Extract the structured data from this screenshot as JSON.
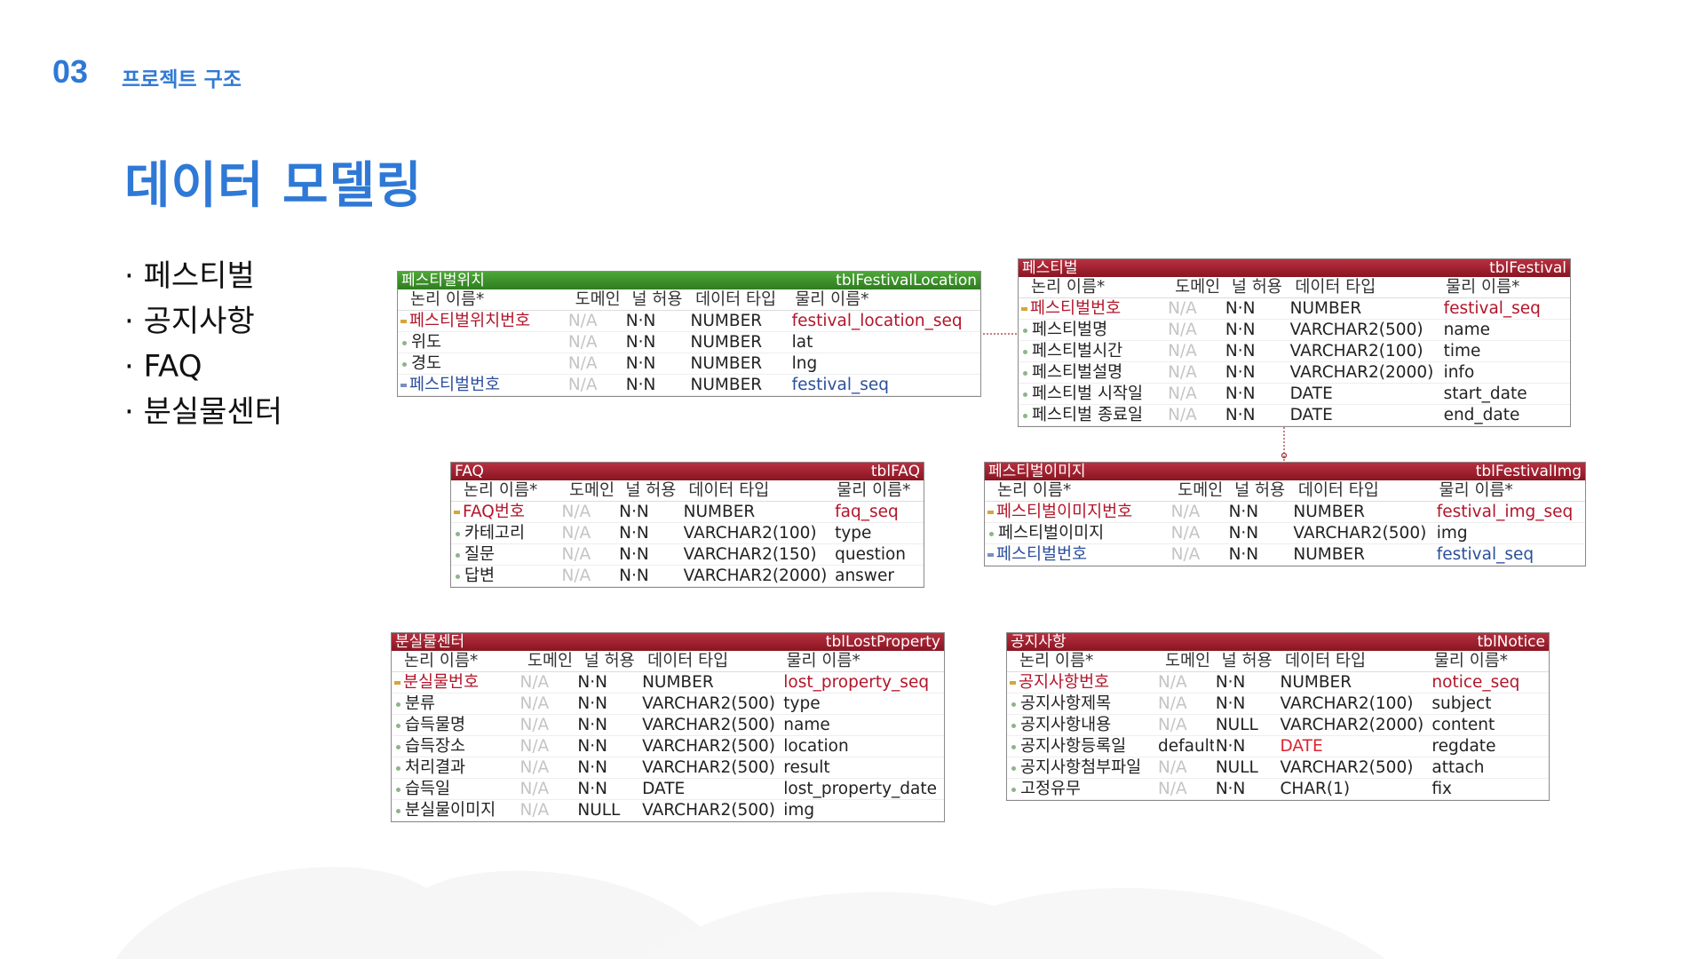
{
  "header": {
    "section_number": "03",
    "section_title": "프로젝트 구조"
  },
  "title": "데이터 모델링",
  "topics": [
    "페스티벌",
    "공지사항",
    "FAQ",
    "분실물센터"
  ],
  "erd_columns": {
    "logical": "논리 이름*",
    "domain": "도메인",
    "nullable": "널 허용",
    "datatype": "데이터 타입",
    "physical": "물리 이름*"
  },
  "colors": {
    "accent": "#2f79d6",
    "entity_header": "#8a1522",
    "location_header": "#2f7d1f",
    "pk_text": "#b3152a",
    "fk_text": "#2a4f9c"
  },
  "tables": {
    "location": {
      "logical": "페스티벌위치",
      "physical": "tblFestivalLocation",
      "rows": [
        {
          "kind": "pk",
          "logical": "페스티벌위치번호",
          "domain": "N/A",
          "nullable": "N·N",
          "datatype": "NUMBER",
          "physical": "festival_location_seq"
        },
        {
          "kind": "col",
          "logical": "위도",
          "domain": "N/A",
          "nullable": "N·N",
          "datatype": "NUMBER",
          "physical": "lat"
        },
        {
          "kind": "col",
          "logical": "경도",
          "domain": "N/A",
          "nullable": "N·N",
          "datatype": "NUMBER",
          "physical": "lng"
        },
        {
          "kind": "fk",
          "logical": "페스티벌번호",
          "domain": "N/A",
          "nullable": "N·N",
          "datatype": "NUMBER",
          "physical": "festival_seq"
        }
      ]
    },
    "festival": {
      "logical": "페스티벌",
      "physical": "tblFestival",
      "rows": [
        {
          "kind": "pk",
          "logical": "페스티벌번호",
          "domain": "N/A",
          "nullable": "N·N",
          "datatype": "NUMBER",
          "physical": "festival_seq"
        },
        {
          "kind": "col",
          "logical": "페스티벌명",
          "domain": "N/A",
          "nullable": "N·N",
          "datatype": "VARCHAR2(500)",
          "physical": "name"
        },
        {
          "kind": "col",
          "logical": "페스티벌시간",
          "domain": "N/A",
          "nullable": "N·N",
          "datatype": "VARCHAR2(100)",
          "physical": "time"
        },
        {
          "kind": "col",
          "logical": "페스티벌설명",
          "domain": "N/A",
          "nullable": "N·N",
          "datatype": "VARCHAR2(2000)",
          "physical": "info"
        },
        {
          "kind": "col",
          "logical": "페스티벌 시작일",
          "domain": "N/A",
          "nullable": "N·N",
          "datatype": "DATE",
          "physical": "start_date"
        },
        {
          "kind": "col",
          "logical": "페스티벌 종료일",
          "domain": "N/A",
          "nullable": "N·N",
          "datatype": "DATE",
          "physical": "end_date"
        }
      ]
    },
    "faq": {
      "logical": "FAQ",
      "physical": "tblFAQ",
      "rows": [
        {
          "kind": "pk",
          "logical": "FAQ번호",
          "domain": "N/A",
          "nullable": "N·N",
          "datatype": "NUMBER",
          "physical": "faq_seq"
        },
        {
          "kind": "col",
          "logical": "카테고리",
          "domain": "N/A",
          "nullable": "N·N",
          "datatype": "VARCHAR2(100)",
          "physical": "type"
        },
        {
          "kind": "col",
          "logical": "질문",
          "domain": "N/A",
          "nullable": "N·N",
          "datatype": "VARCHAR2(150)",
          "physical": "question"
        },
        {
          "kind": "col",
          "logical": "답변",
          "domain": "N/A",
          "nullable": "N·N",
          "datatype": "VARCHAR2(2000)",
          "physical": "answer"
        }
      ]
    },
    "festival_img": {
      "logical": "페스티벌이미지",
      "physical": "tblFestivalImg",
      "rows": [
        {
          "kind": "pk",
          "logical": "페스티벌이미지번호",
          "domain": "N/A",
          "nullable": "N·N",
          "datatype": "NUMBER",
          "physical": "festival_img_seq"
        },
        {
          "kind": "col",
          "logical": "페스티벌이미지",
          "domain": "N/A",
          "nullable": "N·N",
          "datatype": "VARCHAR2(500)",
          "physical": "img"
        },
        {
          "kind": "fk",
          "logical": "페스티벌번호",
          "domain": "N/A",
          "nullable": "N·N",
          "datatype": "NUMBER",
          "physical": "festival_seq"
        }
      ]
    },
    "lost": {
      "logical": "분실물센터",
      "physical": "tblLostProperty",
      "rows": [
        {
          "kind": "pk",
          "logical": "분실물번호",
          "domain": "N/A",
          "nullable": "N·N",
          "datatype": "NUMBER",
          "physical": "lost_property_seq"
        },
        {
          "kind": "col",
          "logical": "분류",
          "domain": "N/A",
          "nullable": "N·N",
          "datatype": "VARCHAR2(500)",
          "physical": "type"
        },
        {
          "kind": "col",
          "logical": "습득물명",
          "domain": "N/A",
          "nullable": "N·N",
          "datatype": "VARCHAR2(500)",
          "physical": "name"
        },
        {
          "kind": "col",
          "logical": "습득장소",
          "domain": "N/A",
          "nullable": "N·N",
          "datatype": "VARCHAR2(500)",
          "physical": "location"
        },
        {
          "kind": "col",
          "logical": "처리결과",
          "domain": "N/A",
          "nullable": "N·N",
          "datatype": "VARCHAR2(500)",
          "physical": "result"
        },
        {
          "kind": "col",
          "logical": "습득일",
          "domain": "N/A",
          "nullable": "N·N",
          "datatype": "DATE",
          "physical": "lost_property_date"
        },
        {
          "kind": "col",
          "logical": "분실물이미지",
          "domain": "N/A",
          "nullable": "NULL",
          "datatype": "VARCHAR2(500)",
          "physical": "img"
        }
      ]
    },
    "notice": {
      "logical": "공지사항",
      "physical": "tblNotice",
      "rows": [
        {
          "kind": "pk",
          "logical": "공지사항번호",
          "domain": "N/A",
          "nullable": "N·N",
          "datatype": "NUMBER",
          "physical": "notice_seq"
        },
        {
          "kind": "col",
          "logical": "공지사항제목",
          "domain": "N/A",
          "nullable": "N·N",
          "datatype": "VARCHAR2(100)",
          "physical": "subject"
        },
        {
          "kind": "col",
          "logical": "공지사항내용",
          "domain": "N/A",
          "nullable": "NULL",
          "datatype": "VARCHAR2(2000)",
          "physical": "content"
        },
        {
          "kind": "col",
          "logical": "공지사항등록일",
          "domain": "default",
          "nullable": "N·N",
          "datatype": "DATE",
          "physical": "regdate",
          "datatype_highlight": true
        },
        {
          "kind": "col",
          "logical": "공지사항첨부파일",
          "domain": "N/A",
          "nullable": "NULL",
          "datatype": "VARCHAR2(500)",
          "physical": "attach"
        },
        {
          "kind": "col",
          "logical": "고정유무",
          "domain": "N/A",
          "nullable": "N·N",
          "datatype": "CHAR(1)",
          "physical": "fix"
        }
      ]
    }
  }
}
